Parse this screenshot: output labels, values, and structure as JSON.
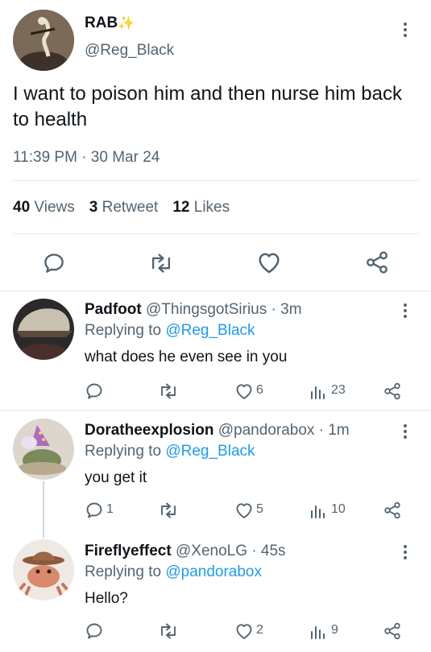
{
  "main_tweet": {
    "display_name": "RAB",
    "name_badge": "✨",
    "handle": "@Reg_Black",
    "text": "I want to poison him and then nurse him back to health",
    "timestamp": "11:39 PM · 30 Mar 24",
    "stats": {
      "views_count": "40",
      "views_label": "Views",
      "retweets_count": "3",
      "retweets_label": "Retweet",
      "likes_count": "12",
      "likes_label": "Likes"
    },
    "actions": [
      "reply-icon",
      "retweet-icon",
      "like-icon",
      "share-icon"
    ]
  },
  "replies": [
    {
      "display_name": "Padfoot",
      "handle": "@ThingsgotSirius",
      "time": "· 3m",
      "replying_prefix": "Replying to",
      "replying_to": "@Reg_Black",
      "text": "what does he even see in you",
      "reply_count": "",
      "retweet_count": "",
      "like_count": "6",
      "view_count": "23"
    },
    {
      "display_name": "Doratheexplosion",
      "handle": "@pandorabox",
      "time": "· 1m",
      "replying_prefix": "Replying to",
      "replying_to": "@Reg_Black",
      "text": "you get it",
      "reply_count": "1",
      "retweet_count": "",
      "like_count": "5",
      "view_count": "10"
    },
    {
      "display_name": "Fireflyeffect",
      "handle": "@XenoLG",
      "time": "· 45s",
      "replying_prefix": "Replying to",
      "replying_to": "@pandorabox",
      "text": "Hello?",
      "reply_count": "",
      "retweet_count": "",
      "like_count": "2",
      "view_count": "9"
    }
  ],
  "colors": {
    "link": "#1d9bf0",
    "muted": "#536471",
    "text": "#0f1419",
    "divider": "#e6e9eb"
  }
}
